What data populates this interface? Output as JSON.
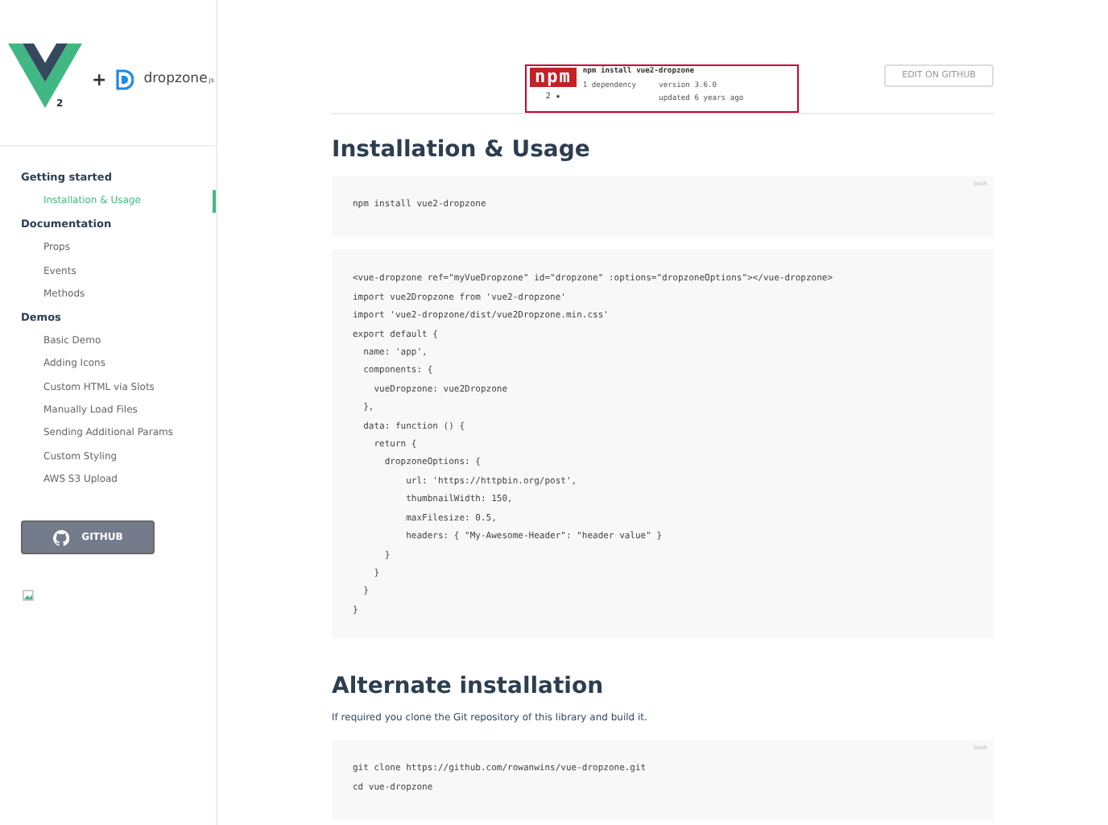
{
  "sidebar": {
    "logo": {
      "version": "2",
      "plus": "+",
      "partner": "dropzone",
      "partner_suffix": "js"
    },
    "sections": [
      {
        "title": "Getting started",
        "items": [
          {
            "label": "Installation & Usage",
            "selected": true
          }
        ]
      },
      {
        "title": "Documentation",
        "items": [
          {
            "label": "Props",
            "selected": false
          },
          {
            "label": "Events",
            "selected": false
          },
          {
            "label": "Methods",
            "selected": false
          }
        ]
      },
      {
        "title": "Demos",
        "items": [
          {
            "label": "Basic Demo",
            "selected": false
          },
          {
            "label": "Adding Icons",
            "selected": false
          },
          {
            "label": "Custom HTML via Slots",
            "selected": false
          },
          {
            "label": "Manually Load Files",
            "selected": false
          },
          {
            "label": "Sending Additional Params",
            "selected": false
          },
          {
            "label": "Custom Styling",
            "selected": false
          },
          {
            "label": "AWS S3 Upload",
            "selected": false
          }
        ]
      }
    ],
    "github_button": "GITHUB"
  },
  "npm_badge": {
    "logo_text": "npm",
    "command": "npm install vue2-dropzone",
    "dependencies": "1 dependency",
    "version": "version 3.6.0",
    "updated": "updated 6 years ago",
    "stars": "2 ★"
  },
  "edit_button": "EDIT ON GITHUB",
  "content": [
    {
      "kind": "heading",
      "text": "Installation & Usage"
    },
    {
      "kind": "code",
      "language": "bash",
      "lines": [
        "npm install vue2-dropzone"
      ]
    },
    {
      "kind": "code",
      "lines": [
        "<vue-dropzone ref=\"myVueDropzone\" id=\"dropzone\" :options=\"dropzoneOptions\"></vue-dropzone>",
        "import vue2Dropzone from 'vue2-dropzone'",
        "import 'vue2-dropzone/dist/vue2Dropzone.min.css'",
        "export default {",
        "  name: 'app',",
        "  components: {",
        "    vueDropzone: vue2Dropzone",
        "  },",
        "  data: function () {",
        "    return {",
        "      dropzoneOptions: {",
        "          url: 'https://httpbin.org/post',",
        "          thumbnailWidth: 150,",
        "          maxFilesize: 0.5,",
        "          headers: { \"My-Awesome-Header\": \"header value\" }",
        "      }",
        "    }",
        "  }",
        "}"
      ]
    },
    {
      "kind": "heading",
      "text": "Alternate installation"
    },
    {
      "kind": "paragraph",
      "text": "If required you clone the Git repository of this library and build it."
    },
    {
      "kind": "code",
      "language": "bash",
      "lines": [
        "git clone https://github.com/rowanwins/vue-dropzone.git",
        "cd vue-dropzone"
      ]
    }
  ]
}
